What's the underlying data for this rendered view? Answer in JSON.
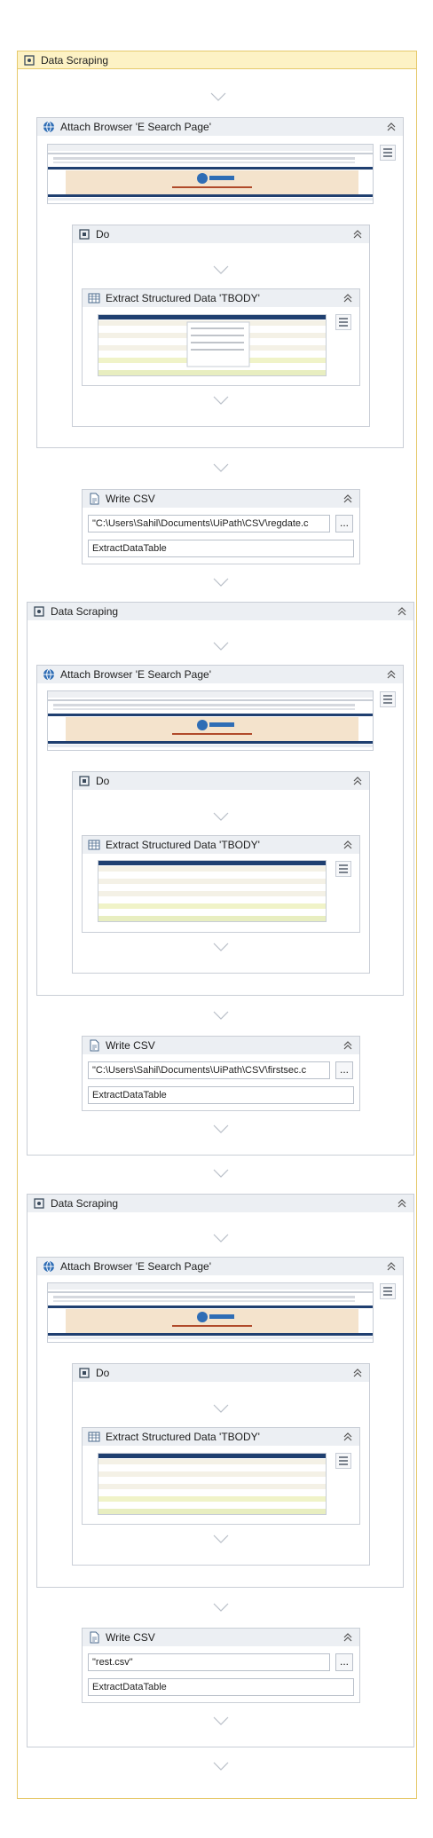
{
  "colors": {
    "outer_header_bg": "#fdf2c5",
    "outer_border": "#e6c96b",
    "activity_header_bg": "#eceff3",
    "activity_border": "#c9ced6",
    "arrow_color": "#b9bfc8"
  },
  "root": {
    "title": "Data Scraping",
    "icon": "data-scraping-icon"
  },
  "blocks": [
    {
      "attach_title": "Attach Browser 'E Search Page'",
      "do_title": "Do",
      "extract_title": "Extract Structured Data 'TBODY'",
      "write_title": "Write CSV",
      "write_path": "\"C:\\Users\\Sahil\\Documents\\UiPath\\CSV\\regdate.c",
      "write_table": "ExtractDataTable"
    },
    {
      "scope_title": "Data Scraping",
      "attach_title": "Attach Browser 'E Search Page'",
      "do_title": "Do",
      "extract_title": "Extract Structured Data 'TBODY'",
      "write_title": "Write CSV",
      "write_path": "\"C:\\Users\\Sahil\\Documents\\UiPath\\CSV\\firstsec.c",
      "write_table": "ExtractDataTable"
    },
    {
      "scope_title": "Data Scraping",
      "attach_title": "Attach Browser 'E Search Page'",
      "do_title": "Do",
      "extract_title": "Extract Structured Data 'TBODY'",
      "write_title": "Write CSV",
      "write_path": "\"rest.csv\"",
      "write_table": "ExtractDataTable"
    }
  ],
  "ellipsis_label": "..."
}
